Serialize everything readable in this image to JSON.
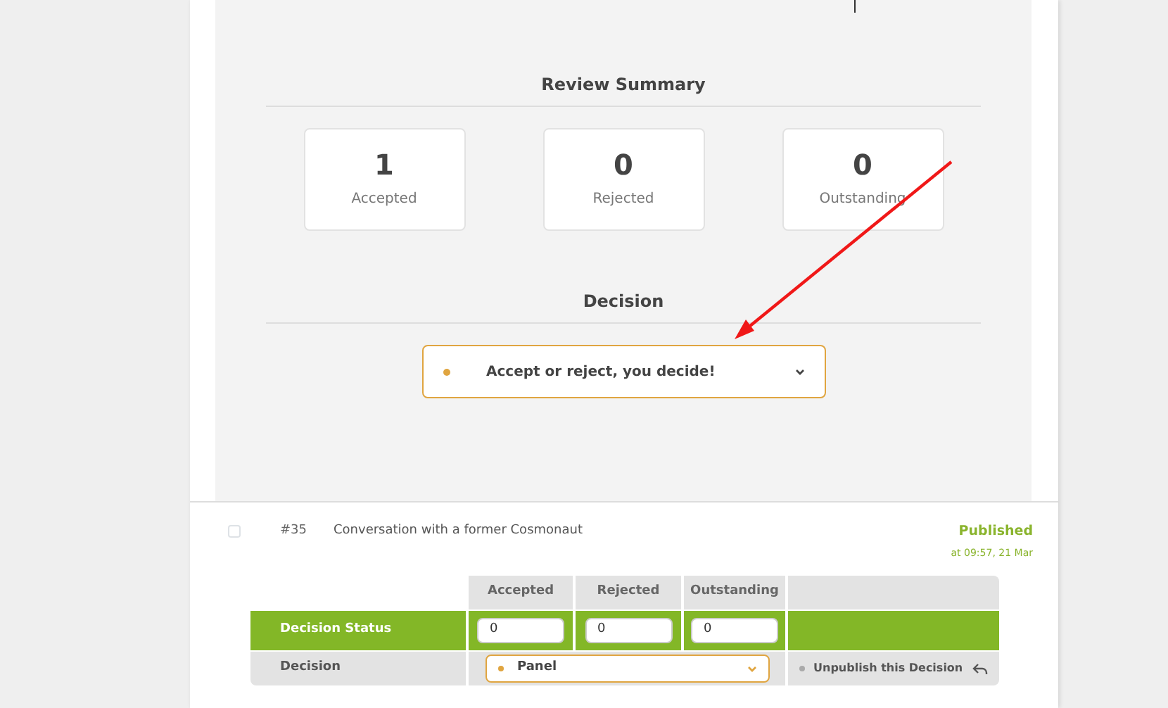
{
  "review_summary": {
    "title": "Review Summary",
    "stats": [
      {
        "value": "1",
        "label": "Accepted"
      },
      {
        "value": "0",
        "label": "Rejected"
      },
      {
        "value": "0",
        "label": "Outstanding"
      }
    ]
  },
  "decision": {
    "title": "Decision",
    "select": {
      "value": "Accept or reject, you decide!"
    }
  },
  "submission": {
    "checked": false,
    "number": "#35",
    "title": "Conversation with a former Cosmonaut",
    "status": "Published",
    "time": "at 09:57, 21 Mar"
  },
  "decision_table": {
    "columns": [
      "Accepted",
      "Rejected",
      "Outstanding"
    ],
    "status_row": {
      "label": "Decision Status",
      "values": [
        "0",
        "0",
        "0"
      ]
    },
    "decision_row": {
      "label": "Decision",
      "select_value": "Panel",
      "action": "Unpublish this Decision"
    }
  }
}
